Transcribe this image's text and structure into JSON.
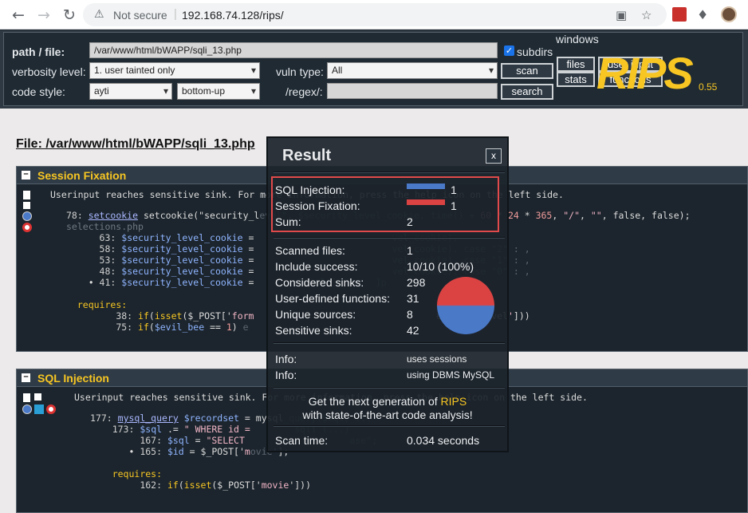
{
  "browser": {
    "security_label": "Not secure",
    "url": "192.168.74.128/rips/"
  },
  "toolbar": {
    "path_label": "path / file:",
    "path_value": "/var/www/html/bWAPP/sqli_13.php",
    "subdirs_label": "subdirs",
    "verbosity_label": "verbosity level:",
    "verbosity_value": "1. user tainted only",
    "vulntype_label": "vuln type:",
    "vulntype_value": "All",
    "codestyle_label": "code style:",
    "codestyle_value": "ayti",
    "direction_value": "bottom-up",
    "regex_label": "/regex/:",
    "scan_label": "scan",
    "search_label": "search",
    "windows_label": "windows",
    "files_label": "files",
    "stats_label": "stats",
    "userinput_label": "user input",
    "functions_label": "functions",
    "logo_text": "RIPS",
    "version": "0.55"
  },
  "main": {
    "file_title": "File: /var/www/html/bWAPP/sqli_13.php"
  },
  "vulns": [
    {
      "title": "Session Fixation",
      "intro": "Userinput reaches sensitive sink. For more information, press the help icon on the left side."
    },
    {
      "title": "SQL Injection",
      "intro": "Userinput reaches sensitive sink. For more information, press the help icon on the left side."
    }
  ],
  "result": {
    "title": "Result",
    "close_label": "x",
    "rows": [
      {
        "label": "SQL Injection:",
        "value": "1"
      },
      {
        "label": "Session Fixation:",
        "value": "1"
      },
      {
        "label": "Sum:",
        "value": "2"
      }
    ],
    "stats": [
      {
        "label": "Scanned files:",
        "value": "1"
      },
      {
        "label": "Include success:",
        "value": "10/10 (100%)"
      },
      {
        "label": "Considered sinks:",
        "value": "298"
      },
      {
        "label": "User-defined functions:",
        "value": "31"
      },
      {
        "label": "Unique sources:",
        "value": "8"
      },
      {
        "label": "Sensitive sinks:",
        "value": "42"
      }
    ],
    "info": [
      {
        "label": "Info:",
        "value": "uses sessions"
      },
      {
        "label": "Info:",
        "value": "using DBMS MySQL"
      }
    ],
    "promo_line1": "Get the next generation of",
    "promo_brand": "RIPS",
    "promo_line2": "with state-of-the-art code analysis!",
    "scan_time_label": "Scan time:",
    "scan_time_value": "0.034 seconds",
    "colors": {
      "sql_injection": "#4a79c8",
      "session_fixation": "#db4343"
    }
  }
}
